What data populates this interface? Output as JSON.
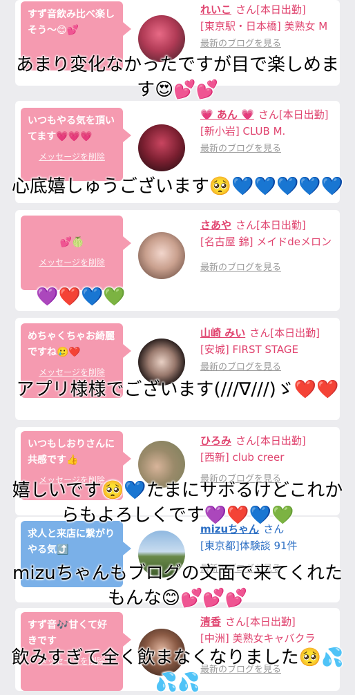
{
  "delete_label": "メッセージを削除",
  "blog_label": "最新のブログを見る",
  "suffix": "さん",
  "cards": [
    {
      "message": "すず音飲み比べ楽しそう〜😊💕",
      "name": "れいこ",
      "status": "[本日出勤]",
      "shop": "[東京駅・日本橋] 美熟女 M",
      "blog": "最新のブログを見る"
    },
    {
      "message": "いつもやる気を頂いてます💗💗💗",
      "name": "💗 あん 💗",
      "status": "[本日出勤]",
      "shop": "[新小岩] CLUB M.",
      "blog": "最新のブログを見る"
    },
    {
      "message": "💕🍈",
      "name": "さあや",
      "status": "[本日出勤]",
      "shop": "[名古屋 錦] メイドdeメロン",
      "blog": "最新のブログを見る"
    },
    {
      "message": "めちゃくちゃお綺麗ですね🥲❤️",
      "name": "山崎 みい",
      "status": "[本日出勤]",
      "shop": "[安城] FIRST STAGE",
      "blog": "最新のブログを見る"
    },
    {
      "message": "いつもしおりさんに共感です👍",
      "name": "ひろみ",
      "status": "[本日出勤]",
      "shop": "[西新] club creer",
      "blog": "最新のブログを見る"
    },
    {
      "message": "求人と来店に繋がりやる気⤴️",
      "name": "mizuちゃん",
      "status": "",
      "shop": "[東京都]体験談 91件",
      "blog": "最新のブログを見る"
    },
    {
      "message": "すず音🎶甘くて好きです",
      "name": "清香",
      "status": "[本日出勤]",
      "shop": "[中洲] 美熟女キャバクラ",
      "blog": "最新のブログを見る"
    }
  ],
  "captions": [
    "あまり変化なかったですが目で楽しめます😍💕💕",
    "心底嬉しゅうございます🥺💙💙💙💙💙",
    "💜❤️💙💚",
    "アプリ様様でございます(///∇///)ゞ❤️❤️",
    "嬉しいです🥺💙たまにサボるけどこれからもよろしくです💜❤️💙💚",
    "mizuちゃんもブログの文面で来てくれたもんな😊💕💕💕",
    "飲みすぎて全く飲まなくなりました🥺💦💦💦"
  ],
  "colors": {
    "pink_bubble": "#f59ab0",
    "blue_bubble": "#7ab0e8",
    "name_pink": "#e0446f",
    "name_blue": "#2c6fc4",
    "background": "#ececef"
  }
}
